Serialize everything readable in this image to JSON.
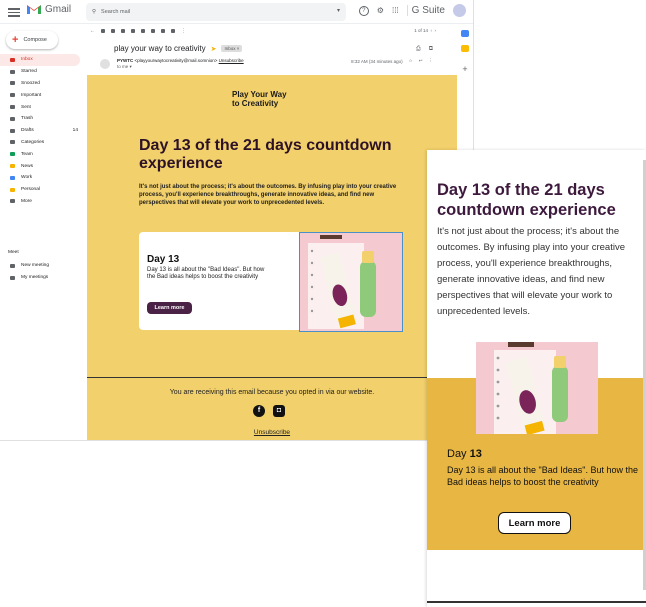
{
  "app": {
    "logo": "Gmail",
    "search_placeholder": "Search mail",
    "suite_label": "G Suite",
    "help": "?",
    "settings": "⚙",
    "apps": "⋮⋮⋮"
  },
  "sidebar": {
    "compose_label": "Compose",
    "items": [
      {
        "label": "Inbox",
        "count": "",
        "color": "#d93025"
      },
      {
        "label": "Starred",
        "count": "",
        "color": "#5f6368"
      },
      {
        "label": "Snoozed",
        "count": "",
        "color": "#5f6368"
      },
      {
        "label": "Important",
        "count": "",
        "color": "#5f6368"
      },
      {
        "label": "Sent",
        "count": "",
        "color": "#5f6368"
      },
      {
        "label": "Trash",
        "count": "",
        "color": "#5f6368"
      },
      {
        "label": "Drafts",
        "count": "14",
        "color": "#5f6368"
      },
      {
        "label": "Categories",
        "count": "",
        "color": "#5f6368"
      },
      {
        "label": "Team",
        "count": "",
        "color": "#0f9d58"
      },
      {
        "label": "News",
        "count": "",
        "color": "#f4b400"
      },
      {
        "label": "Work",
        "count": "",
        "color": "#4285f4"
      },
      {
        "label": "Personal",
        "count": "",
        "color": "#f4b400"
      },
      {
        "label": "More",
        "count": "",
        "color": "#5f6368"
      }
    ],
    "meet": {
      "title": "Meet",
      "new_meeting": "New meeting",
      "my_meetings": "My meetings"
    }
  },
  "toolbar": {
    "pager": "1 of 14"
  },
  "email_header": {
    "subject": "play your way to creativity",
    "label": "Inbox ×",
    "sender_name": "PYWTC",
    "sender_email": "<playyourwaytocreativity@mail.somnion>",
    "unsubscribe_hint": "Unsubscribe",
    "to": "to me ▾",
    "time": "8:32 AM (34 minutes ago)"
  },
  "email": {
    "brand_line1": "Play Your Way",
    "brand_line2": "to Creativity",
    "heading": "Day 13 of the 21 days countdown experience",
    "lead": "It's not just about the process; it's about the outcomes. By infusing play into your creative process, you'll experience breakthroughs, generate innovative ideas, and find new perspectives that will elevate your work to unprecedented levels.",
    "card_title": "Day 13",
    "card_text": "Day 13 is all about the \"Bad Ideas\". But how the Bad ideas helps to boost the creativity",
    "card_button": "Learn more",
    "footer_text": "You are receiving this email because you opted in via our website.",
    "unsubscribe": "Unsubscribe"
  },
  "mobile": {
    "heading": "Day 13 of the 21 days countdown experience",
    "lead": "It's not just about the process; it's about the outcomes. By infusing play into your creative process, you'll experience breakthroughs, generate innovative ideas, and find new perspectives that will elevate your work to unprecedented levels.",
    "day_prefix": "Day",
    "day_number": "13",
    "desc": "Day 13 is all about the \"Bad Ideas\". But how the Bad ideas helps to boost the creativity",
    "button": "Learn more"
  },
  "colors": {
    "email_bg": "#f2d06b",
    "mobile_yellow": "#e8b642",
    "heading": "#2d1227",
    "button": "#4a2245"
  }
}
